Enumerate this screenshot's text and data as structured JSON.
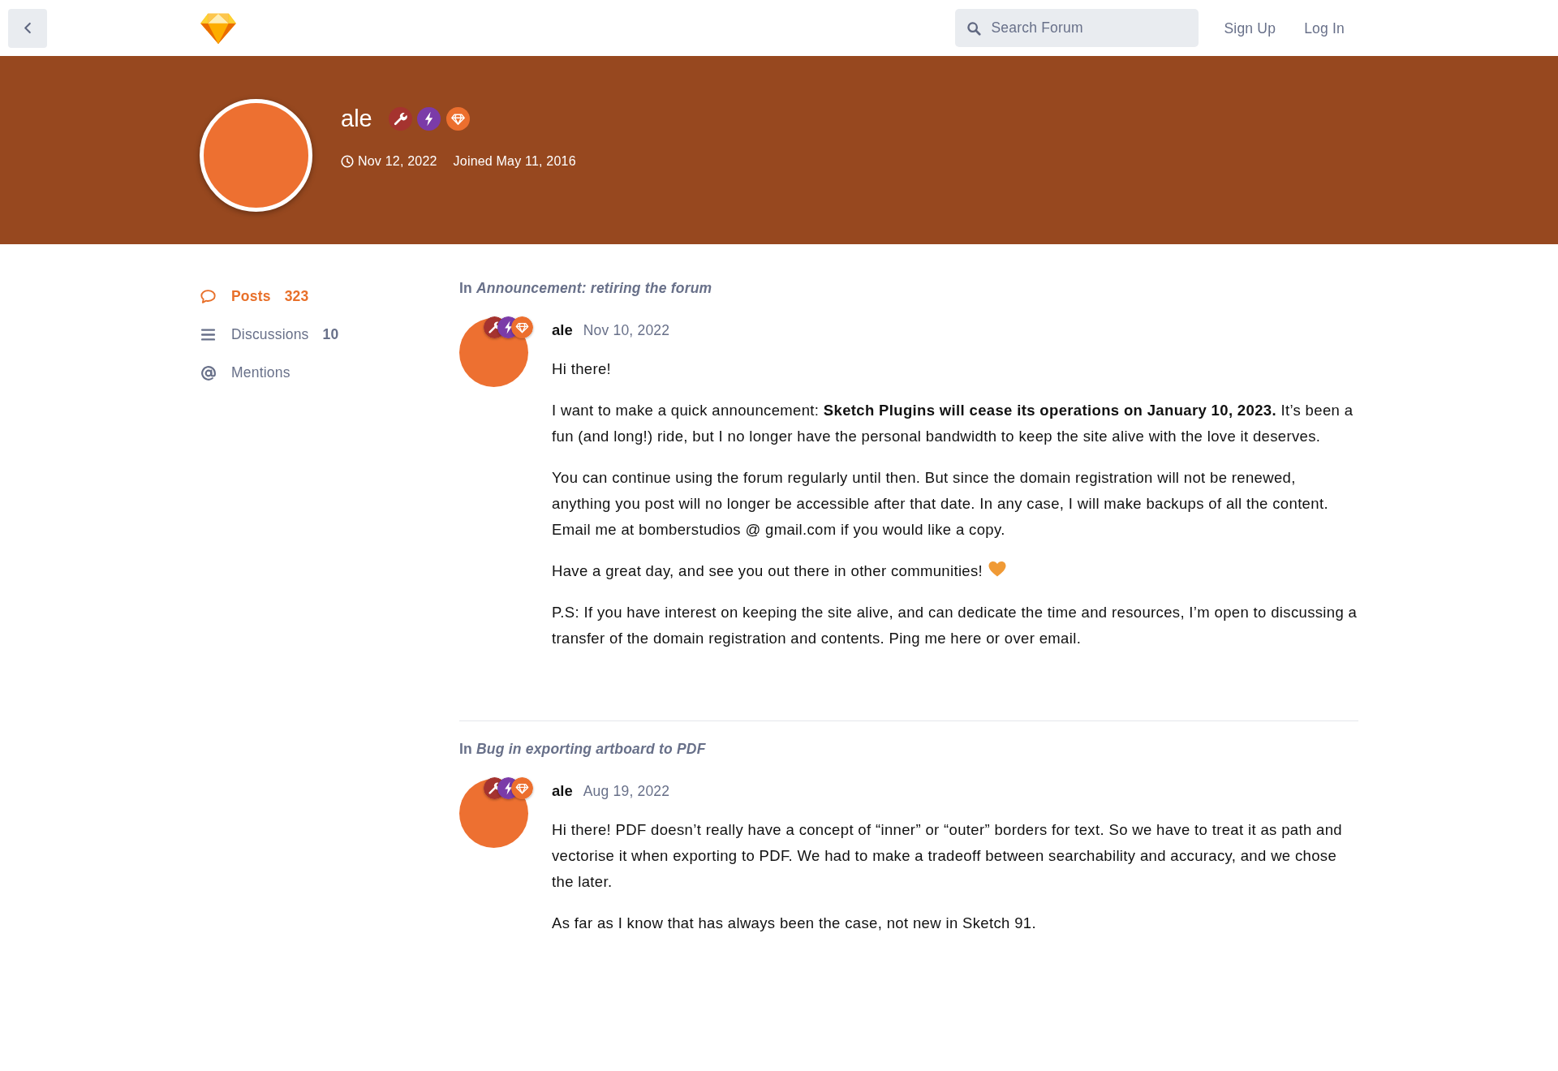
{
  "top_bar": {
    "search": {
      "placeholder": "Search Forum"
    },
    "links": [
      "Sign Up",
      "Log In"
    ]
  },
  "profile": {
    "username": "ale",
    "badges": [
      {
        "kind": "wrench",
        "color": "#a5332f"
      },
      {
        "kind": "bolt",
        "color": "#7b3ba8"
      },
      {
        "kind": "diamond",
        "color": "#ec6f2e"
      }
    ],
    "last_seen": "Nov 12, 2022",
    "joined": "Joined May 11, 2016"
  },
  "sidebar": {
    "items": [
      {
        "kind": "posts",
        "label": "Posts",
        "count": "323",
        "selected": true
      },
      {
        "kind": "discussions",
        "label": "Discussions",
        "count": "10",
        "selected": false
      },
      {
        "kind": "mentions",
        "label": "Mentions",
        "selected": false
      }
    ]
  },
  "posts": [
    {
      "discussion": "In *Announcement: retiring the forum*",
      "author": "ale",
      "badges": [
        {
          "kind": "wrench",
          "color": "#a5332f"
        },
        {
          "kind": "bolt",
          "color": "#7b3ba8"
        },
        {
          "kind": "diamond",
          "color": "#ec6f2e"
        }
      ],
      "date": "Nov 10, 2022",
      "paragraphs": [
        {
          "kind": "plain",
          "text": "Hi there!"
        },
        {
          "kind": "plain",
          "text": "I want to make a quick announcement: **Sketch Plugins will cease its operations on January 10, 2023.** It’s been a fun (and long!) ride, but I no longer have the personal bandwidth to keep the site alive with the love it deserves."
        },
        {
          "kind": "plain",
          "text": "You can continue using the forum regularly until then. But since the domain registration will not be renewed, anything you post will no longer be accessible after that date. In any case, I will make backups of all the content. Email me at bomberstudios @ gmail.com if you would like a copy."
        },
        {
          "kind": "hearted",
          "text": "Have a great day, and see you out there in other communities!"
        },
        {
          "kind": "plain",
          "text": "P.S: If you have interest on keeping the site alive, and can dedicate the time and resources, I’m open to discussing a transfer of the domain registration and contents. Ping me here or over email."
        }
      ]
    },
    {
      "discussion": "In *Bug in exporting artboard to PDF*",
      "author": "ale",
      "badges": [
        {
          "kind": "wrench",
          "color": "#a5332f"
        },
        {
          "kind": "bolt",
          "color": "#7b3ba8"
        },
        {
          "kind": "diamond",
          "color": "#ec6f2e"
        }
      ],
      "date": "Aug 19, 2022",
      "paragraphs": [
        {
          "kind": "plain",
          "text": "Hi there! PDF doesn’t really have a concept of “inner” or “outer” borders for text. So we have to treat it as path and vectorise it when exporting to PDF. We had to make a tradeoff between searchability and accuracy, and we chose the later."
        },
        {
          "kind": "plain",
          "text": "As far as I know that has always been the case, not new in Sketch 91."
        }
      ]
    }
  ]
}
